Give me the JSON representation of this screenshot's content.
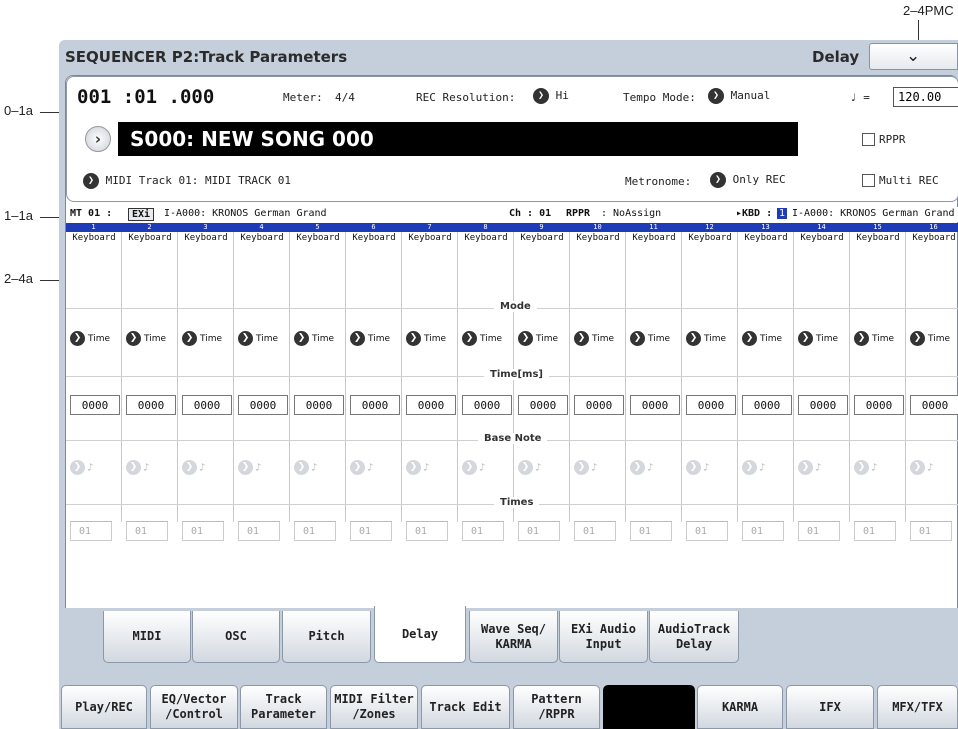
{
  "callouts": {
    "c0": "0–1a",
    "c1": "1–1a",
    "c2": "2–4a",
    "c3": "2–4PMC"
  },
  "header": {
    "title": "SEQUENCER P2:Track Parameters",
    "page_name": "Delay",
    "menu_icon": "chevron-down-icon"
  },
  "transport": {
    "position": "001 :01 .000",
    "meter_label": "Meter:",
    "meter_value": "4/4",
    "rec_res_label": "REC Resolution:",
    "rec_res_value": "Hi",
    "tempo_mode_label": "Tempo Mode:",
    "tempo_mode_value": "Manual",
    "tempo_symbol": "♩ =",
    "tempo_value": "120.00"
  },
  "song": {
    "name": "S000: NEW SONG 000",
    "rppr_label": "RPPR",
    "multi_rec_label": "Multi REC"
  },
  "track": {
    "label": "MIDI Track 01: MIDI TRACK 01",
    "metronome_label": "Metronome:",
    "metronome_value": "Only REC"
  },
  "mt_row": {
    "mt": "MT 01 :",
    "exi": "EXi",
    "program": "I-A000: KRONOS German Grand",
    "ch": "Ch  : 01",
    "rppr": "RPPR",
    "rppr_value": ": NoAssign",
    "kbd": "▸KBD :",
    "kbd_badge": "1",
    "kbd_program": "I-A000: KRONOS German Grand"
  },
  "sections": {
    "mode": "Mode",
    "time": "Time[ms]",
    "base_note": "Base Note",
    "times": "Times"
  },
  "tracks": [
    {
      "num": "1",
      "type": "Keyboard",
      "mode": "Time",
      "time": "0000",
      "times": "01"
    },
    {
      "num": "2",
      "type": "Keyboard",
      "mode": "Time",
      "time": "0000",
      "times": "01"
    },
    {
      "num": "3",
      "type": "Keyboard",
      "mode": "Time",
      "time": "0000",
      "times": "01"
    },
    {
      "num": "4",
      "type": "Keyboard",
      "mode": "Time",
      "time": "0000",
      "times": "01"
    },
    {
      "num": "5",
      "type": "Keyboard",
      "mode": "Time",
      "time": "0000",
      "times": "01"
    },
    {
      "num": "6",
      "type": "Keyboard",
      "mode": "Time",
      "time": "0000",
      "times": "01"
    },
    {
      "num": "7",
      "type": "Keyboard",
      "mode": "Time",
      "time": "0000",
      "times": "01"
    },
    {
      "num": "8",
      "type": "Keyboard",
      "mode": "Time",
      "time": "0000",
      "times": "01"
    },
    {
      "num": "9",
      "type": "Keyboard",
      "mode": "Time",
      "time": "0000",
      "times": "01"
    },
    {
      "num": "10",
      "type": "Keyboard",
      "mode": "Time",
      "time": "0000",
      "times": "01"
    },
    {
      "num": "11",
      "type": "Keyboard",
      "mode": "Time",
      "time": "0000",
      "times": "01"
    },
    {
      "num": "12",
      "type": "Keyboard",
      "mode": "Time",
      "time": "0000",
      "times": "01"
    },
    {
      "num": "13",
      "type": "Keyboard",
      "mode": "Time",
      "time": "0000",
      "times": "01"
    },
    {
      "num": "14",
      "type": "Keyboard",
      "mode": "Time",
      "time": "0000",
      "times": "01"
    },
    {
      "num": "15",
      "type": "Keyboard",
      "mode": "Time",
      "time": "0000",
      "times": "01"
    },
    {
      "num": "16",
      "type": "Keyboard",
      "mode": "Time",
      "time": "0000",
      "times": "01"
    }
  ],
  "base_note_icon": "♪",
  "tabs_top": [
    {
      "label": "MIDI"
    },
    {
      "label": "OSC"
    },
    {
      "label": "Pitch"
    },
    {
      "label": "Delay",
      "active": true
    },
    {
      "label": "Wave Seq/\nKARMA"
    },
    {
      "label": "EXi Audio\nInput"
    },
    {
      "label": "AudioTrack\nDelay"
    }
  ],
  "tabs_bottom": [
    {
      "label": "Play/REC"
    },
    {
      "label": "EQ/Vector\n/Control"
    },
    {
      "label": "Track\nParameter"
    },
    {
      "label": "MIDI Filter\n/Zones"
    },
    {
      "label": "Track Edit"
    },
    {
      "label": "Pattern\n/RPPR"
    },
    {
      "label": ""
    },
    {
      "label": "KARMA"
    },
    {
      "label": "IFX"
    },
    {
      "label": "MFX/TFX"
    }
  ],
  "colors": {
    "screen_bg": "#c5cedb",
    "track_header": "#1e3bb8",
    "song_bg": "#000000"
  }
}
